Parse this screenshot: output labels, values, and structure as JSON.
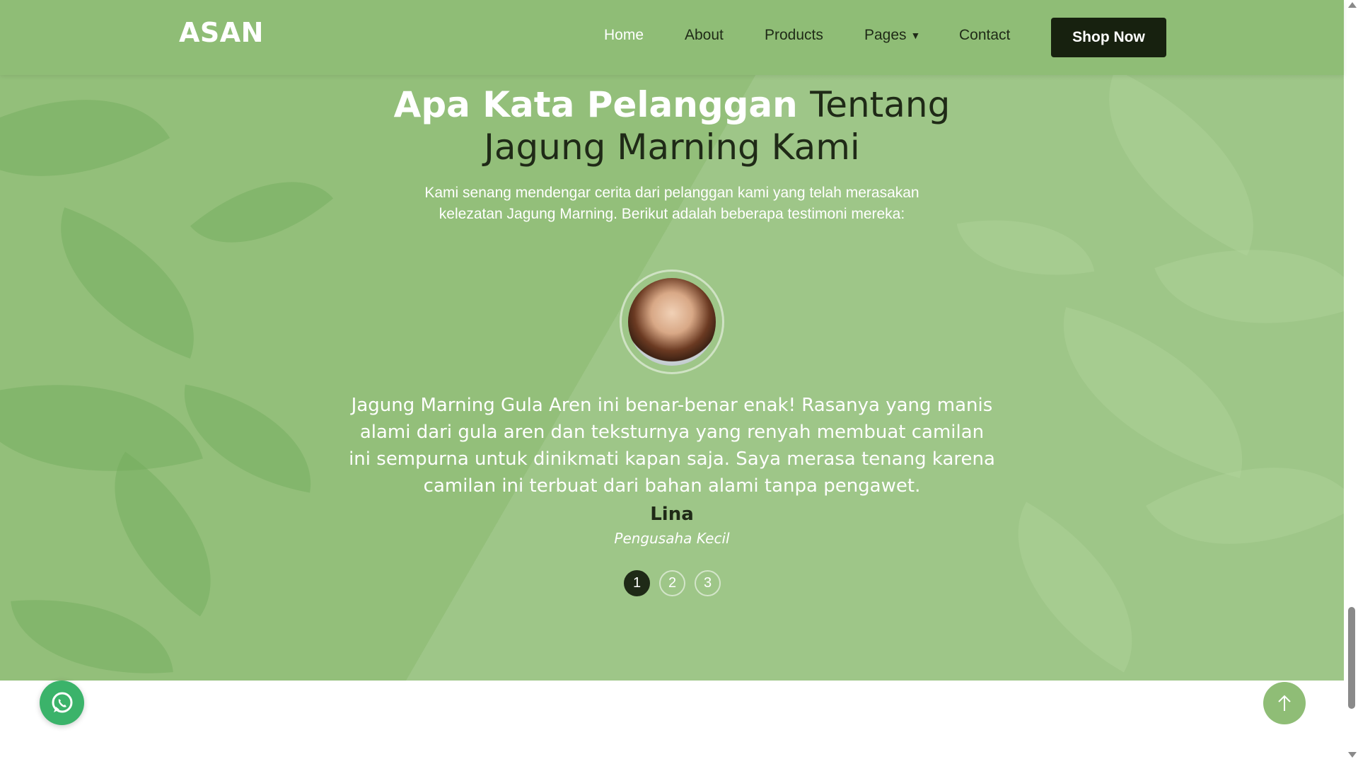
{
  "nav": {
    "brand": "ASAN",
    "items": [
      {
        "label": "Home",
        "active": true
      },
      {
        "label": "About"
      },
      {
        "label": "Products"
      },
      {
        "label": "Pages",
        "has_dropdown": true
      },
      {
        "label": "Contact"
      }
    ],
    "cta_label": "Shop Now"
  },
  "testimonials": {
    "heading_strong": "Apa Kata Pelanggan",
    "heading_light_1": "Tentang",
    "heading_light_2": "Jagung Marning Kami",
    "intro_line_1": "Kami senang mendengar cerita dari pelanggan kami yang telah merasakan",
    "intro_line_2": "kelezatan Jagung Marning. Berikut adalah beberapa testimoni mereka:",
    "quote": "Jagung Marning Gula Aren ini benar-benar enak! Rasanya yang manis alami dari gula aren dan teksturnya yang renyah membuat camilan ini sempurna untuk dinikmati kapan saja. Saya merasa tenang karena camilan ini terbuat dari bahan alami tanpa pengawet.",
    "name": "Lina",
    "role": "Pengusaha Kecil",
    "pagination": [
      "1",
      "2",
      "3"
    ],
    "active_page": "1"
  },
  "floating": {
    "whatsapp_icon": "whatsapp-icon",
    "back_to_top_icon": "arrow-up-icon"
  },
  "colors": {
    "section_bg": "#93bf7a",
    "nav_bg": "#8fbd76",
    "dark": "#17210f",
    "whatsapp": "#3bb36a"
  }
}
